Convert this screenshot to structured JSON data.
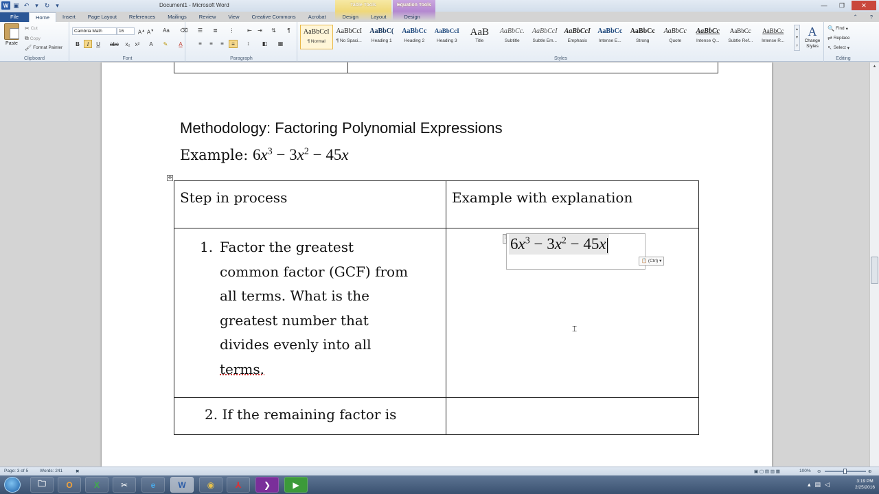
{
  "window": {
    "title": "Document1 - Microsoft Word"
  },
  "contextual_tabs": {
    "table_tools": {
      "label": "Table Tools",
      "color": "#efd87a",
      "tabs": [
        "Design",
        "Layout"
      ]
    },
    "equation_tools": {
      "label": "Equation Tools",
      "color": "#b488d0",
      "tabs": [
        "Design"
      ]
    }
  },
  "tabs": [
    "File",
    "Home",
    "Insert",
    "Page Layout",
    "References",
    "Mailings",
    "Review",
    "View",
    "Creative Commons",
    "Acrobat"
  ],
  "ribbon": {
    "clipboard": {
      "paste": "Paste",
      "cut": "Cut",
      "copy": "Copy",
      "format_painter": "Format Painter",
      "label": "Clipboard"
    },
    "font": {
      "family": "Cambria Math",
      "size": "16",
      "label": "Font"
    },
    "paragraph": {
      "label": "Paragraph"
    },
    "styles": {
      "label": "Styles",
      "items": [
        {
          "sample": "AaBbCcI",
          "name": "¶ Normal"
        },
        {
          "sample": "AaBbCcI",
          "name": "¶ No Spaci..."
        },
        {
          "sample": "AaBbC(",
          "name": "Heading 1"
        },
        {
          "sample": "AaBbCc",
          "name": "Heading 2"
        },
        {
          "sample": "AaBbCcI",
          "name": "Heading 3"
        },
        {
          "sample": "AaB",
          "name": "Title"
        },
        {
          "sample": "AaBbCc.",
          "name": "Subtitle"
        },
        {
          "sample": "AaBbCcI",
          "name": "Subtle Em..."
        },
        {
          "sample": "AaBbCcI",
          "name": "Emphasis"
        },
        {
          "sample": "AaBbCc",
          "name": "Intense E..."
        },
        {
          "sample": "AaBbCc",
          "name": "Strong"
        },
        {
          "sample": "AaBbCc",
          "name": "Quote"
        },
        {
          "sample": "AaBbCc",
          "name": "Intense Q..."
        },
        {
          "sample": "AaBbCc",
          "name": "Subtle Ref..."
        },
        {
          "sample": "AaBbCc",
          "name": "Intense R..."
        }
      ],
      "change_styles": "Change Styles"
    },
    "editing": {
      "find": "Find",
      "replace": "Replace",
      "select": "Select",
      "label": "Editing"
    }
  },
  "document": {
    "heading": "Methodology: Factoring Polynomial Expressions",
    "example_label": "Example:",
    "table": {
      "headers": [
        "Step in process",
        "Example with explanation"
      ],
      "step1_number": "1.",
      "step1_lines": [
        "Factor the greatest",
        "common factor (GCF) from",
        "all terms. What is the",
        "greatest number that",
        "divides evenly into all"
      ],
      "step1_last": "terms.",
      "step2_number": "2.",
      "step2_text": "If the remaining factor is"
    },
    "paste_options": "(Ctrl)"
  },
  "status": {
    "page": "Page: 3 of 5",
    "words": "Words: 241",
    "zoom": "100%"
  },
  "clock": {
    "time": "3:19 PM",
    "date": "2/25/2016"
  }
}
